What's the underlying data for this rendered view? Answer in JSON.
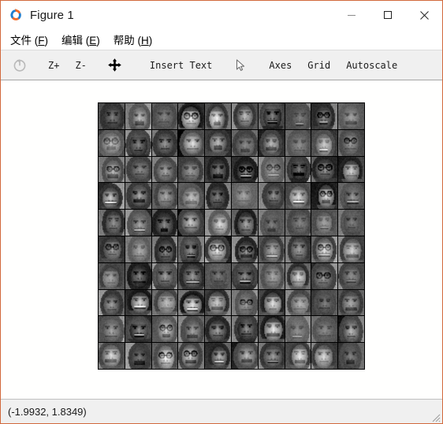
{
  "window": {
    "title": "Figure 1",
    "icon": "octave-circular-arrows-icon",
    "border_color": "#d2693c",
    "controls": [
      {
        "name": "minimize",
        "glyph": "minimize-icon"
      },
      {
        "name": "maximize",
        "glyph": "maximize-icon"
      },
      {
        "name": "close",
        "glyph": "close-icon"
      }
    ]
  },
  "menubar": {
    "items": [
      {
        "label": "文件",
        "accel": "F"
      },
      {
        "label": "编辑",
        "accel": "E"
      },
      {
        "label": "帮助",
        "accel": "H"
      }
    ]
  },
  "toolbar": {
    "items": [
      {
        "type": "icon",
        "name": "reset-rotation-icon",
        "label": "",
        "enabled": false
      },
      {
        "type": "label",
        "name": "zoom-in-button",
        "label": "Z+",
        "enabled": true
      },
      {
        "type": "label",
        "name": "zoom-out-button",
        "label": "Z-",
        "enabled": true
      },
      {
        "type": "icon",
        "name": "pan-move-icon",
        "label": "",
        "enabled": true
      },
      {
        "type": "label",
        "name": "insert-text-button",
        "label": "Insert Text",
        "enabled": true
      },
      {
        "type": "icon",
        "name": "pointer-select-icon",
        "label": "",
        "enabled": true
      },
      {
        "type": "label",
        "name": "axes-button",
        "label": "Axes",
        "enabled": true
      },
      {
        "type": "label",
        "name": "grid-button",
        "label": "Grid",
        "enabled": true
      },
      {
        "type": "label",
        "name": "autoscale-button",
        "label": "Autoscale",
        "enabled": true
      }
    ]
  },
  "figure": {
    "name": "face-image-montage",
    "description": "10 by 10 montage of grayscale face photographs",
    "rows": 10,
    "columns": 10,
    "tile_count": 100,
    "colormap": "gray",
    "background_color": "#ffffff",
    "border_color": "#000000"
  },
  "statusbar": {
    "coordinates": "(-1.9932, 1.8349)",
    "resize_grip": "resize-grip-icon"
  }
}
